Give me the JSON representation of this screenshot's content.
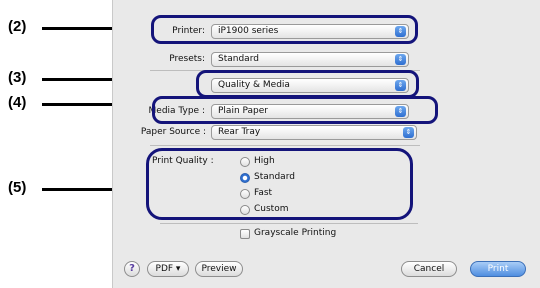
{
  "callouts": [
    "(2)",
    "(3)",
    "(4)",
    "(5)"
  ],
  "printer": {
    "label": "Printer:",
    "value": "iP1900 series"
  },
  "presets": {
    "label": "Presets:",
    "value": "Standard"
  },
  "panel": {
    "value": "Quality & Media"
  },
  "media_type": {
    "label": "Media Type :",
    "value": "Plain Paper"
  },
  "paper_source": {
    "label": "Paper Source :",
    "value": "Rear Tray"
  },
  "print_quality": {
    "label": "Print Quality :",
    "options": [
      "High",
      "Standard",
      "Fast",
      "Custom"
    ],
    "selected": "Standard"
  },
  "grayscale": {
    "label": "Grayscale Printing",
    "checked": false
  },
  "buttons": {
    "help": "?",
    "pdf": "PDF ▾",
    "preview": "Preview",
    "cancel": "Cancel",
    "print": "Print"
  },
  "colors": {
    "highlight": "#14147a",
    "accent": "#2f6fd0"
  }
}
